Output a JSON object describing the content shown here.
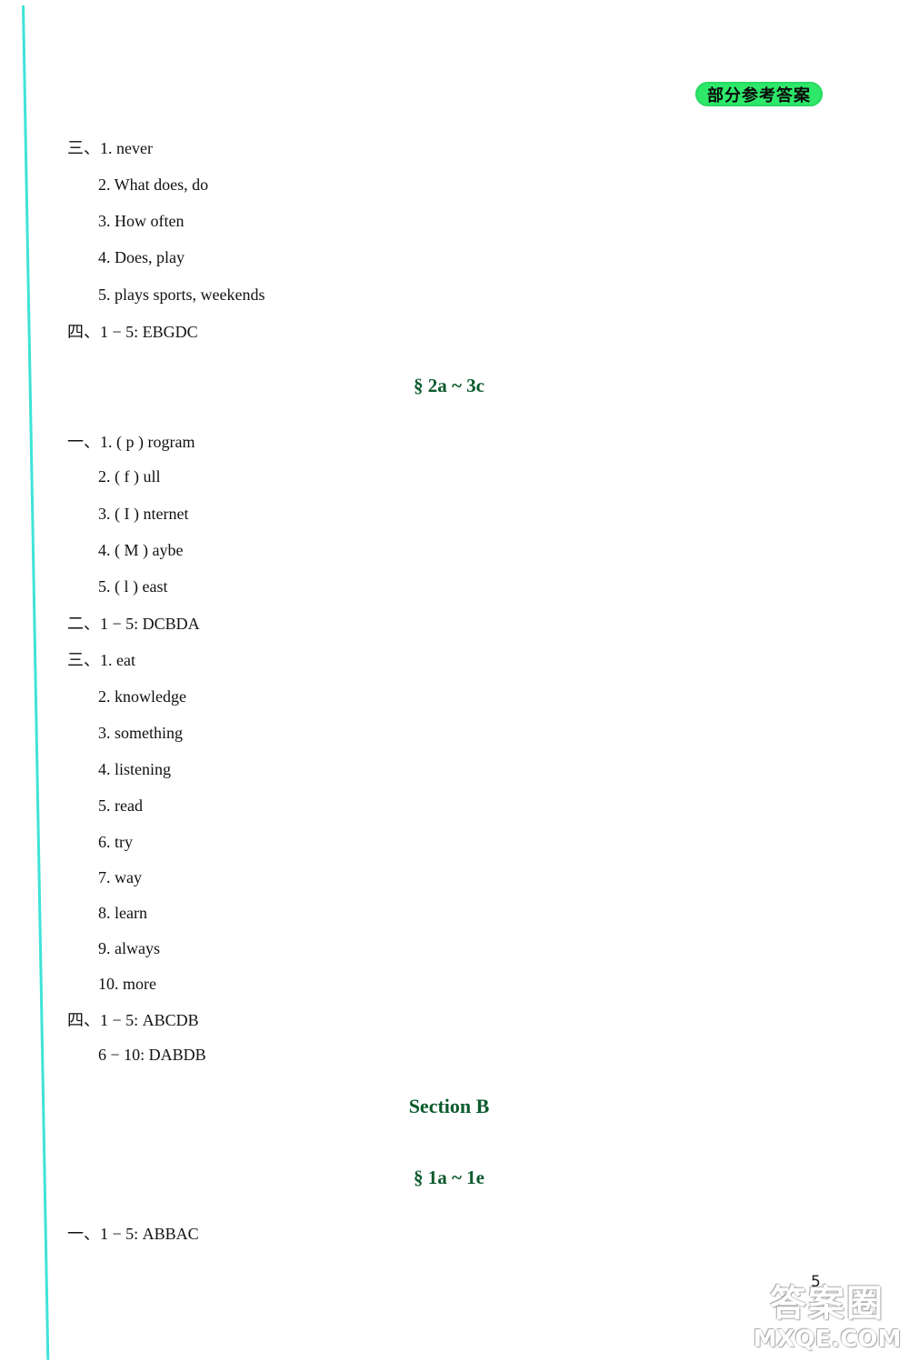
{
  "badge": {
    "label": "部分参考答案",
    "color": "#2ee86a"
  },
  "margin_line_color": "#3fe3d8",
  "heading_color": "#0b5a2c",
  "lines": [
    "三、1. never",
    "2. What does, do",
    "3. How often",
    "4. Does, play",
    "5. plays sports, weekends",
    "四、1 − 5: EBGDC",
    "一、1. ( p ) rogram",
    "2. ( f ) ull",
    "3. ( I ) nternet",
    "4. ( M ) aybe",
    "5. ( l ) east",
    "二、1 − 5: DCBDA",
    "三、1. eat",
    "2. knowledge",
    "3. something",
    "4. listening",
    "5. read",
    "6. try",
    "7. way",
    "8. learn",
    "9. always",
    "10. more",
    "四、1 − 5: ABCDB",
    "6 − 10: DABDB",
    "一、1 − 5: ABBAC"
  ],
  "headings": {
    "section_2a_3c": "§ 2a ~ 3c",
    "section_b": "Section B",
    "section_1a_1e": "§ 1a ~ 1e"
  },
  "page_number": "5",
  "watermark": {
    "cn": "答案圈",
    "en": "MXQE.COM"
  }
}
